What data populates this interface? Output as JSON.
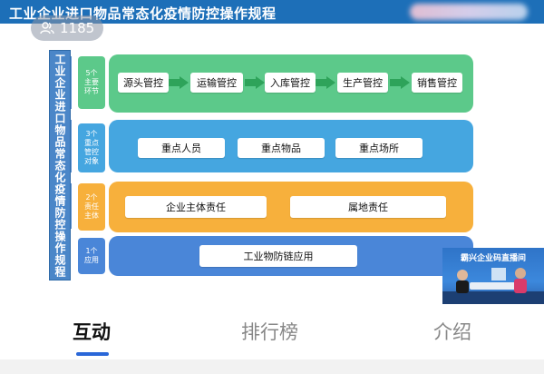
{
  "slide": {
    "title": "工业企业进口物品常态化疫情防控操作规程",
    "vertical_title": "工业企业进口物品常态化疫情防控操作规程",
    "rows": [
      {
        "label": [
          "5个",
          "主要",
          "环节"
        ],
        "items": [
          "源头管控",
          "运输管控",
          "入库管控",
          "生产管控",
          "销售管控"
        ],
        "color": "#5cc98a"
      },
      {
        "label": [
          "3个",
          "重点",
          "管控",
          "对象"
        ],
        "items": [
          "重点人员",
          "重点物品",
          "重点场所"
        ],
        "color": "#45a6e0"
      },
      {
        "label": [
          "2个",
          "责任",
          "主体"
        ],
        "items": [
          "企业主体责任",
          "属地责任"
        ],
        "color": "#f7b03c"
      },
      {
        "label": [
          "1个",
          "应用"
        ],
        "items": [
          "工业物防链应用"
        ],
        "color": "#4a86d8"
      }
    ]
  },
  "overlay": {
    "viewer_icon": "viewers-icon",
    "viewer_count": "1185"
  },
  "video": {
    "title": "霸兴企业码直播间"
  },
  "tabs": [
    {
      "label": "互动",
      "active": true
    },
    {
      "label": "排行榜",
      "active": false
    },
    {
      "label": "介绍",
      "active": false
    }
  ],
  "colors": {
    "header_blue": "#1d6fb8",
    "accent_blue": "#2a67d8"
  }
}
